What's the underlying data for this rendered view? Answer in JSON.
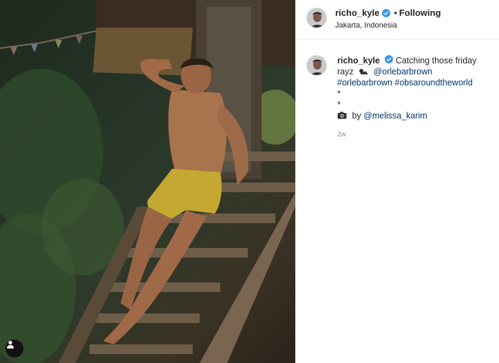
{
  "post": {
    "author": "richo_kyle",
    "follow_status": "Following",
    "separator": "•",
    "location": "Jakarta, Indonesia",
    "caption": {
      "username": "richo_kyle",
      "text_part1": "Catching those friday",
      "text_part2": "rayz",
      "mention1": "@orlebarbrown",
      "hashtag1": "#orlebarbrown",
      "hashtag2": "#obsaroundtheworld",
      "bullet1": "*",
      "bullet2": "*",
      "credit_prefix": "by",
      "credit_mention": "@melissa_karim"
    },
    "timestamp": "2w"
  },
  "colors": {
    "link": "#00376b",
    "verified": "#3897f0",
    "muted": "#8e8e8e"
  },
  "icons": {
    "verified": "verified-badge-icon",
    "user_tag": "user-tag-icon",
    "camera": "camera-icon",
    "sun": "sun-cloud-icon"
  }
}
